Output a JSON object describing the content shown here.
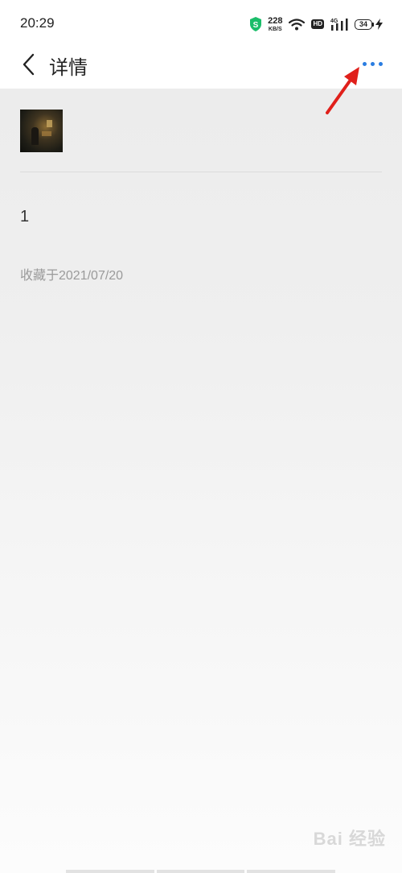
{
  "status_bar": {
    "time": "20:29",
    "net_speed_value": "228",
    "net_speed_unit": "KB/S",
    "hd_label": "HD",
    "network_label": "4G",
    "battery_level": "34"
  },
  "nav": {
    "title": "详情",
    "more_color": "#2a7de1"
  },
  "detail": {
    "item_title": "",
    "value": "1",
    "favorited_date": "收藏于2021/07/20"
  },
  "watermark": "Bai 经验",
  "colors": {
    "annotation_arrow": "#e0201b",
    "accent": "#2a7de1"
  }
}
